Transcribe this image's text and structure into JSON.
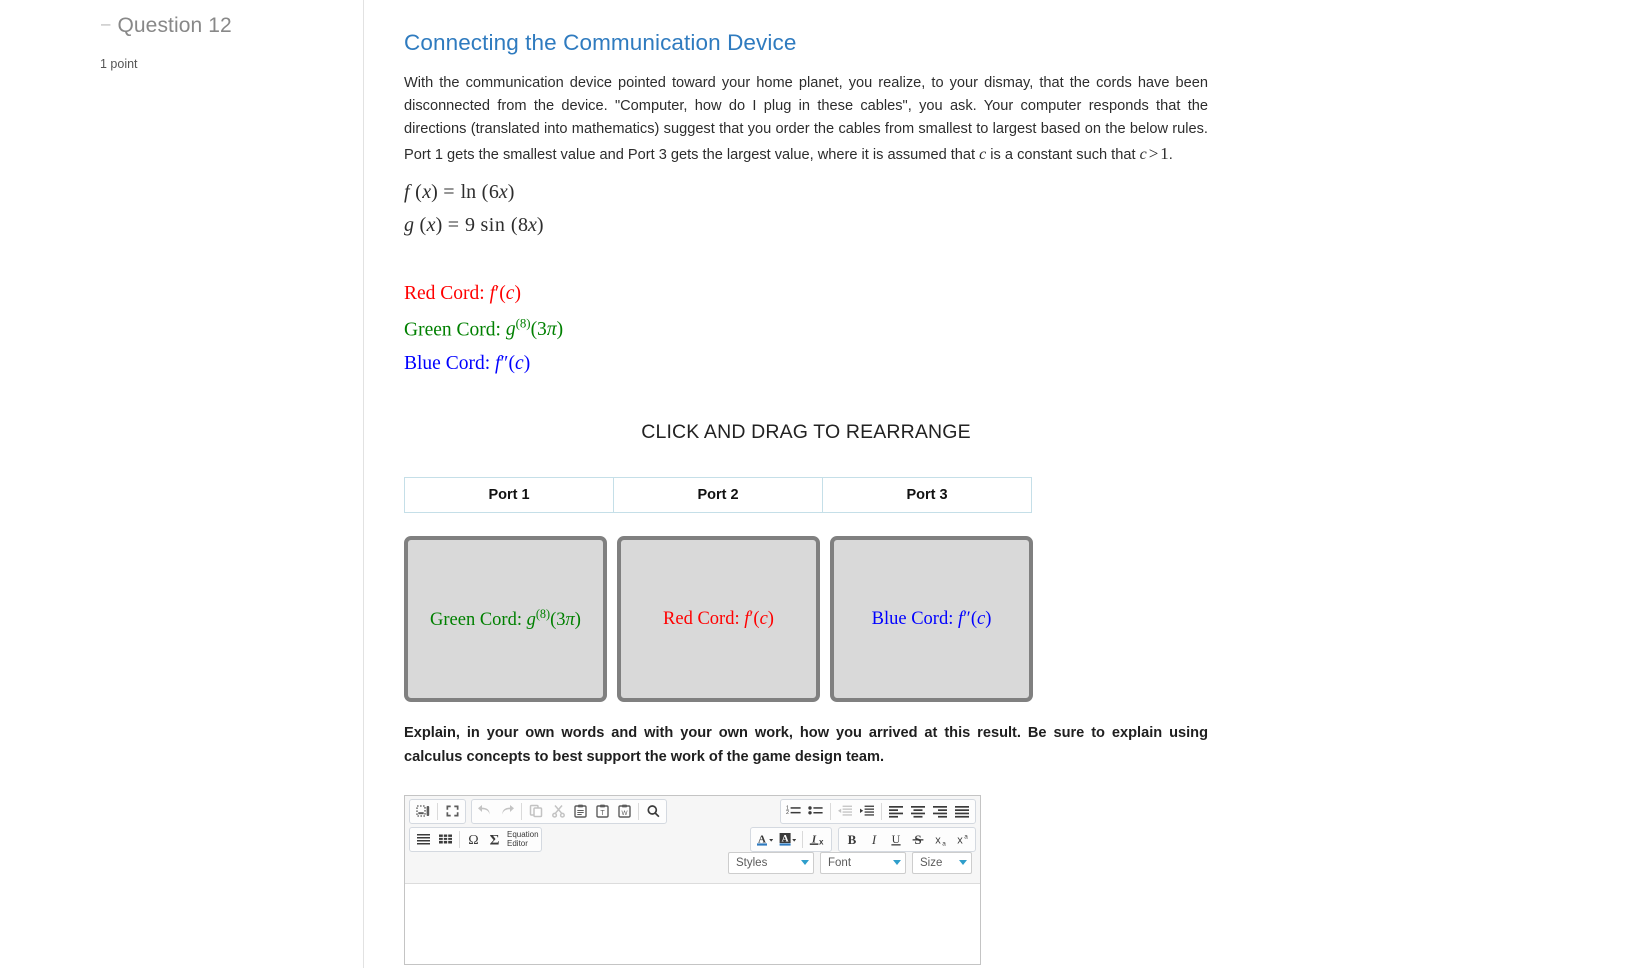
{
  "sidebar": {
    "collapse_glyph": "–",
    "question_label": "Question 12",
    "points_label": "1 point"
  },
  "main": {
    "section_title": "Connecting the Communication Device",
    "paragraph_part1": "With the communication device pointed toward your home planet, you realize, to your dismay, that the cords have been disconnected from the device. \"Computer, how do I plug in these cables\", you ask. Your computer responds that the directions (translated into mathematics) suggest that you order the cables from smallest to largest based on the below rules. Port 1 gets the smallest value and Port 3 gets the largest value, where it is assumed that ",
    "paragraph_var_c": "c",
    "paragraph_part2": " is a constant such that ",
    "paragraph_c2": "c",
    "paragraph_gt": ">",
    "paragraph_one": "1",
    "paragraph_period": ".",
    "equation_f": "f (x) = ln (6x)",
    "equation_g": "g (x) = 9 sin (8x)",
    "cords": [
      {
        "name": "Red Cord:",
        "expr": "f ′(c)",
        "color": "#ff0000",
        "key": "red"
      },
      {
        "name": "Green Cord:",
        "expr": "g (8)(3π)",
        "color": "#008000",
        "key": "green"
      },
      {
        "name": "Blue Cord:",
        "expr": "f ″(c)",
        "color": "#0000ff",
        "key": "blue"
      }
    ],
    "drag_hint": "CLICK AND DRAG TO REARRANGE",
    "ports": [
      "Port 1",
      "Port 2",
      "Port 3"
    ],
    "cards_order": [
      "green",
      "red",
      "blue"
    ],
    "instructions": "Explain, in your own words and with your own work, how you arrived at this result. Be sure to explain using calculus concepts to best support the work of the game design team."
  },
  "editor": {
    "toolbar_row1_left": [
      {
        "name": "source-icon",
        "title": "Source"
      },
      {
        "name": "maximize-icon",
        "title": "Maximize"
      }
    ],
    "toolbar_row1_edit": [
      {
        "name": "undo-icon",
        "title": "Undo"
      },
      {
        "name": "redo-icon",
        "title": "Redo"
      },
      {
        "name": "copy-icon",
        "title": "Copy"
      },
      {
        "name": "cut-icon",
        "title": "Cut"
      },
      {
        "name": "paste-icon",
        "title": "Paste"
      },
      {
        "name": "paste-text-icon",
        "title": "Paste as plain text"
      },
      {
        "name": "paste-word-icon",
        "title": "Paste from Word"
      },
      {
        "name": "find-icon",
        "title": "Find"
      }
    ],
    "toolbar_row1_right": [
      {
        "name": "numbered-list-icon",
        "title": "Insert/Remove Numbered List"
      },
      {
        "name": "bulleted-list-icon",
        "title": "Insert/Remove Bulleted List"
      },
      {
        "name": "outdent-icon",
        "title": "Decrease Indent"
      },
      {
        "name": "indent-icon",
        "title": "Increase Indent"
      },
      {
        "name": "align-left-icon",
        "title": "Align Left"
      },
      {
        "name": "align-center-icon",
        "title": "Center"
      },
      {
        "name": "align-right-icon",
        "title": "Align Right"
      },
      {
        "name": "justify-icon",
        "title": "Justify"
      }
    ],
    "toolbar_row2_left": [
      {
        "name": "horizontal-rule-icon",
        "title": "Insert Horizontal Line"
      },
      {
        "name": "table-icon",
        "title": "Table"
      },
      {
        "name": "special-char-icon",
        "title": "Insert Special Character"
      }
    ],
    "equation_editor_label_line1": "Equation",
    "equation_editor_label_line2": "Editor",
    "toolbar_row2_right": [
      {
        "name": "text-color-icon",
        "title": "Text Color"
      },
      {
        "name": "background-color-icon",
        "title": "Background Color"
      },
      {
        "name": "remove-format-icon",
        "title": "Remove Format"
      }
    ],
    "toolbar_row2_format": [
      {
        "name": "bold-icon",
        "label": "B",
        "title": "Bold"
      },
      {
        "name": "italic-icon",
        "label": "I",
        "title": "Italic"
      },
      {
        "name": "underline-icon",
        "label": "U",
        "title": "Underline"
      },
      {
        "name": "strikethrough-icon",
        "label": "S",
        "title": "Strike Through"
      },
      {
        "name": "subscript-icon",
        "label": "x",
        "sub": "a",
        "title": "Subscript"
      },
      {
        "name": "superscript-icon",
        "label": "x",
        "sup": "a",
        "title": "Superscript"
      }
    ],
    "combos": {
      "styles": "Styles",
      "font": "Font",
      "size": "Size"
    }
  },
  "colors": {
    "heading_blue": "#2f7bbf",
    "port_border": "#c5dfe8",
    "card_fill": "#d9d9d9",
    "card_border": "#808080",
    "red": "#ff0000",
    "green": "#008000",
    "blue": "#0000ff"
  }
}
